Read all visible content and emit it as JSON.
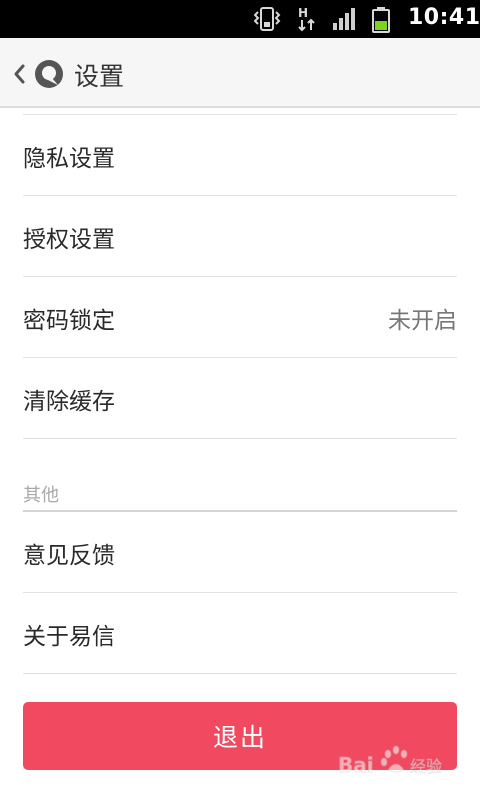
{
  "status_bar": {
    "time": "10:41",
    "network_label": "H",
    "icons": [
      "vibrate-icon",
      "network-h-icon",
      "signal-icon",
      "battery-icon"
    ]
  },
  "header": {
    "title": "设置",
    "icons": [
      "chevron-left-icon",
      "yixin-logo-icon"
    ]
  },
  "settings": {
    "items": [
      {
        "label": "隐私设置",
        "value": ""
      },
      {
        "label": "授权设置",
        "value": ""
      },
      {
        "label": "密码锁定",
        "value": "未开启"
      },
      {
        "label": "清除缓存",
        "value": ""
      }
    ]
  },
  "other": {
    "section_title": "其他",
    "items": [
      {
        "label": "意见反馈"
      },
      {
        "label": "关于易信"
      }
    ]
  },
  "logout": {
    "label": "退出"
  },
  "watermark": {
    "text": "Bai 经验",
    "icon": "baidu-paw-icon"
  },
  "colors": {
    "accent": "#f1495f",
    "status_bar_bg": "#000000",
    "battery_green": "#7fd21f",
    "title_bar_bg": "#f6f6f6"
  }
}
